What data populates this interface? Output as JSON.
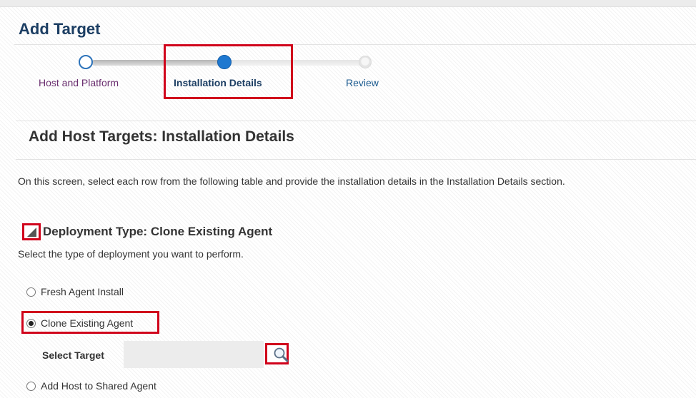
{
  "page": {
    "title": "Add Target"
  },
  "train": {
    "steps": [
      {
        "label": "Host and Platform",
        "state": "visited"
      },
      {
        "label": "Installation Details",
        "state": "current"
      },
      {
        "label": "Review",
        "state": "unvisited"
      }
    ]
  },
  "section": {
    "title": "Add Host Targets: Installation Details",
    "intro": "On this screen, select each row from the following table and provide the installation details in the Installation Details section."
  },
  "deployment": {
    "title": "Deployment Type: Clone Existing Agent",
    "subtitle": "Select the type of deployment you want to perform.",
    "options": [
      "Fresh Agent Install",
      "Clone Existing Agent",
      "Add Host to Shared Agent"
    ],
    "selected": "Clone Existing Agent",
    "select_target": {
      "label": "Select Target",
      "value": ""
    }
  },
  "colors": {
    "title": "#1c3e63",
    "train_active": "#1e78d0",
    "highlight": "#d0021b",
    "visited_step_text": "#6a2e6f"
  },
  "icons": {
    "search": "magnifier-icon",
    "disclose": "disclosure-triangle-icon"
  }
}
